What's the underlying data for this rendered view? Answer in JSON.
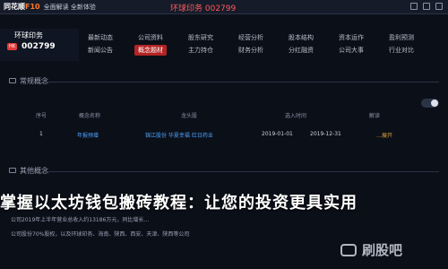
{
  "window": {
    "brand_name": "同花顺",
    "brand_f10": "F10",
    "brand_subtitle": "全面解读 全新体验",
    "title": "环球印务 002799"
  },
  "quote": {
    "name": "环球印务",
    "market_badge": "HK",
    "code": "002799"
  },
  "menu": {
    "items": [
      "最新动态",
      "公司资料",
      "股东研究",
      "经营分析",
      "股本结构",
      "资本运作",
      "盈利预测",
      "新闻公告",
      "概念题材",
      "主力持仓",
      "财务分析",
      "分红融资",
      "公司大事",
      "行业对比"
    ],
    "active_index": 8
  },
  "sections": [
    {
      "label": "常规概念"
    },
    {
      "label": "其他概念"
    }
  ],
  "table": {
    "headers": [
      "序号",
      "概念名称",
      "龙头股",
      "",
      "选入时间",
      "解读"
    ],
    "rows": [
      {
        "index": "1",
        "concept": "年报预增",
        "leaders": "锦江股份  华夏幸福  红日药业",
        "date": "2019-01-01",
        "detail_date": "2019-12-31",
        "detail_text": "…展开"
      }
    ]
  },
  "headline": "掌握以太坊钱包搬砖教程：让您的投资更具实用",
  "fine_print": [
    "公司2019年上半年营业总收入约13186万元，同比增长…",
    "公司股份70%股权，以及环球印务、海南、陕西、西安、天津、陕西等公司"
  ],
  "watermark": "刷股吧"
}
